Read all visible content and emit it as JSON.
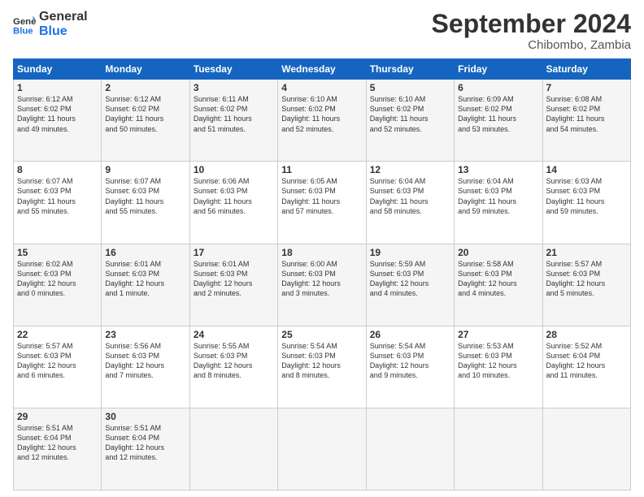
{
  "logo": {
    "line1": "General",
    "line2": "Blue",
    "icon_color": "#1a73e8"
  },
  "header": {
    "month": "September 2024",
    "location": "Chibombo, Zambia"
  },
  "weekdays": [
    "Sunday",
    "Monday",
    "Tuesday",
    "Wednesday",
    "Thursday",
    "Friday",
    "Saturday"
  ],
  "weeks": [
    [
      {
        "day": "1",
        "text": "Sunrise: 6:12 AM\nSunset: 6:02 PM\nDaylight: 11 hours\nand 49 minutes."
      },
      {
        "day": "2",
        "text": "Sunrise: 6:12 AM\nSunset: 6:02 PM\nDaylight: 11 hours\nand 50 minutes."
      },
      {
        "day": "3",
        "text": "Sunrise: 6:11 AM\nSunset: 6:02 PM\nDaylight: 11 hours\nand 51 minutes."
      },
      {
        "day": "4",
        "text": "Sunrise: 6:10 AM\nSunset: 6:02 PM\nDaylight: 11 hours\nand 52 minutes."
      },
      {
        "day": "5",
        "text": "Sunrise: 6:10 AM\nSunset: 6:02 PM\nDaylight: 11 hours\nand 52 minutes."
      },
      {
        "day": "6",
        "text": "Sunrise: 6:09 AM\nSunset: 6:02 PM\nDaylight: 11 hours\nand 53 minutes."
      },
      {
        "day": "7",
        "text": "Sunrise: 6:08 AM\nSunset: 6:02 PM\nDaylight: 11 hours\nand 54 minutes."
      }
    ],
    [
      {
        "day": "8",
        "text": "Sunrise: 6:07 AM\nSunset: 6:03 PM\nDaylight: 11 hours\nand 55 minutes."
      },
      {
        "day": "9",
        "text": "Sunrise: 6:07 AM\nSunset: 6:03 PM\nDaylight: 11 hours\nand 55 minutes."
      },
      {
        "day": "10",
        "text": "Sunrise: 6:06 AM\nSunset: 6:03 PM\nDaylight: 11 hours\nand 56 minutes."
      },
      {
        "day": "11",
        "text": "Sunrise: 6:05 AM\nSunset: 6:03 PM\nDaylight: 11 hours\nand 57 minutes."
      },
      {
        "day": "12",
        "text": "Sunrise: 6:04 AM\nSunset: 6:03 PM\nDaylight: 11 hours\nand 58 minutes."
      },
      {
        "day": "13",
        "text": "Sunrise: 6:04 AM\nSunset: 6:03 PM\nDaylight: 11 hours\nand 59 minutes."
      },
      {
        "day": "14",
        "text": "Sunrise: 6:03 AM\nSunset: 6:03 PM\nDaylight: 11 hours\nand 59 minutes."
      }
    ],
    [
      {
        "day": "15",
        "text": "Sunrise: 6:02 AM\nSunset: 6:03 PM\nDaylight: 12 hours\nand 0 minutes."
      },
      {
        "day": "16",
        "text": "Sunrise: 6:01 AM\nSunset: 6:03 PM\nDaylight: 12 hours\nand 1 minute."
      },
      {
        "day": "17",
        "text": "Sunrise: 6:01 AM\nSunset: 6:03 PM\nDaylight: 12 hours\nand 2 minutes."
      },
      {
        "day": "18",
        "text": "Sunrise: 6:00 AM\nSunset: 6:03 PM\nDaylight: 12 hours\nand 3 minutes."
      },
      {
        "day": "19",
        "text": "Sunrise: 5:59 AM\nSunset: 6:03 PM\nDaylight: 12 hours\nand 4 minutes."
      },
      {
        "day": "20",
        "text": "Sunrise: 5:58 AM\nSunset: 6:03 PM\nDaylight: 12 hours\nand 4 minutes."
      },
      {
        "day": "21",
        "text": "Sunrise: 5:57 AM\nSunset: 6:03 PM\nDaylight: 12 hours\nand 5 minutes."
      }
    ],
    [
      {
        "day": "22",
        "text": "Sunrise: 5:57 AM\nSunset: 6:03 PM\nDaylight: 12 hours\nand 6 minutes."
      },
      {
        "day": "23",
        "text": "Sunrise: 5:56 AM\nSunset: 6:03 PM\nDaylight: 12 hours\nand 7 minutes."
      },
      {
        "day": "24",
        "text": "Sunrise: 5:55 AM\nSunset: 6:03 PM\nDaylight: 12 hours\nand 8 minutes."
      },
      {
        "day": "25",
        "text": "Sunrise: 5:54 AM\nSunset: 6:03 PM\nDaylight: 12 hours\nand 8 minutes."
      },
      {
        "day": "26",
        "text": "Sunrise: 5:54 AM\nSunset: 6:03 PM\nDaylight: 12 hours\nand 9 minutes."
      },
      {
        "day": "27",
        "text": "Sunrise: 5:53 AM\nSunset: 6:03 PM\nDaylight: 12 hours\nand 10 minutes."
      },
      {
        "day": "28",
        "text": "Sunrise: 5:52 AM\nSunset: 6:04 PM\nDaylight: 12 hours\nand 11 minutes."
      }
    ],
    [
      {
        "day": "29",
        "text": "Sunrise: 5:51 AM\nSunset: 6:04 PM\nDaylight: 12 hours\nand 12 minutes."
      },
      {
        "day": "30",
        "text": "Sunrise: 5:51 AM\nSunset: 6:04 PM\nDaylight: 12 hours\nand 12 minutes."
      },
      {
        "day": "",
        "text": ""
      },
      {
        "day": "",
        "text": ""
      },
      {
        "day": "",
        "text": ""
      },
      {
        "day": "",
        "text": ""
      },
      {
        "day": "",
        "text": ""
      }
    ]
  ]
}
